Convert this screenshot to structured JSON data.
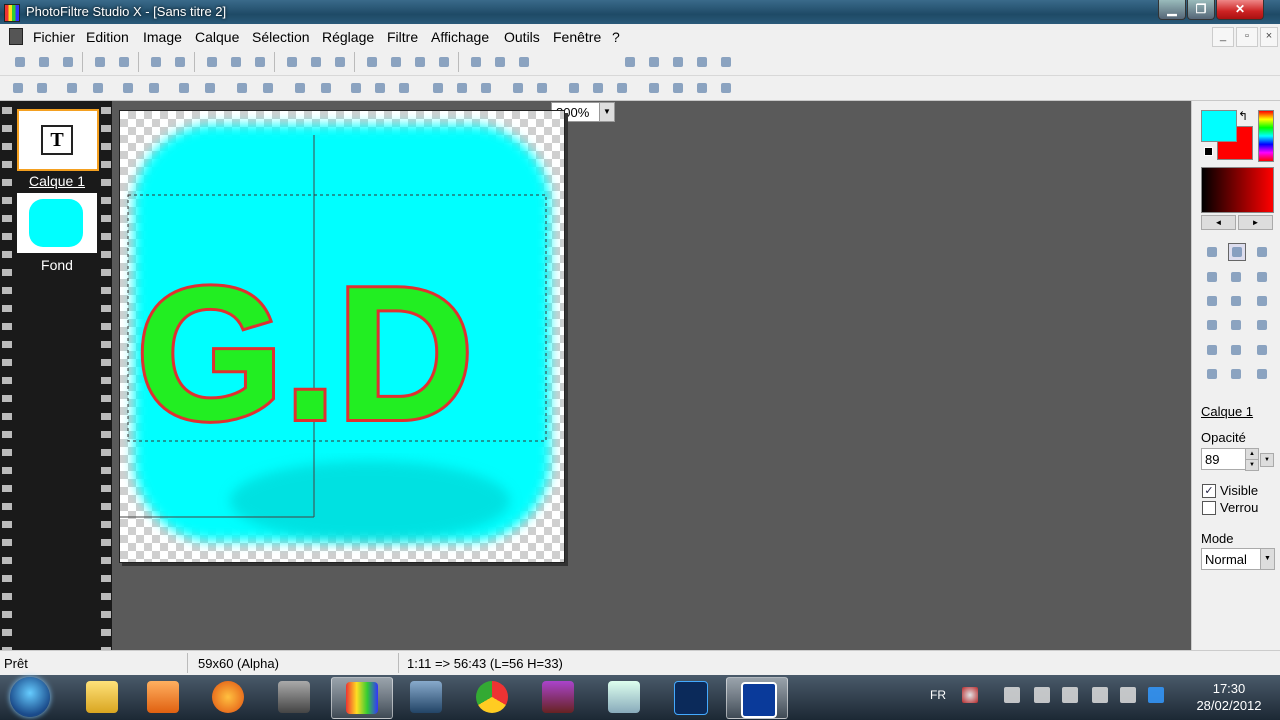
{
  "window": {
    "title": "PhotoFiltre Studio X - [Sans titre 2]"
  },
  "window_buttons": {
    "minimize": "▁",
    "maximize": "❐",
    "close": "✕"
  },
  "menu": {
    "items": [
      "Fichier",
      "Edition",
      "Image",
      "Calque",
      "Sélection",
      "Réglage",
      "Filtre",
      "Affichage",
      "Outils",
      "Fenêtre",
      "?"
    ]
  },
  "mdi_buttons": {
    "minimize": "_",
    "restore": "▫",
    "close": "×"
  },
  "toolbar": {
    "zoom": "800%"
  },
  "layers": [
    {
      "name": "Calque 1",
      "thumb_text": "T",
      "selected": true
    },
    {
      "name": "Fond",
      "selected": false
    }
  ],
  "canvas": {
    "text": "G.D",
    "bg_color": "#00ffff",
    "text_fill": "#22ee22",
    "text_outline": "#e03030"
  },
  "right_panel": {
    "fg_color": "#00ffff",
    "bg_color": "#ff0000",
    "swap_symbol": "↰",
    "layer_name": "Calque 1",
    "opacity_label": "Opacité",
    "opacity_value": "89",
    "visible_label": "Visible",
    "visible_checked": true,
    "lock_label": "Verrou",
    "lock_checked": false,
    "mode_label": "Mode",
    "mode_value": "Normal",
    "check_mark": "✓",
    "arrow_left": "◄",
    "arrow_right": "►",
    "spin_up": "▲",
    "spin_down": "▼",
    "dropdown_arrow": "▼"
  },
  "tools": [
    "pointer-icon",
    "selection-icon",
    "hand-icon",
    "eyedropper-icon",
    "magic-wand-icon",
    "line-icon",
    "fill-bucket-icon",
    "spray-icon",
    "eraser-icon",
    "brush-icon",
    "smart-brush-icon",
    "stamp-icon",
    "drop-icon",
    "smudge-icon",
    "pen-icon",
    "clone-icon",
    "texture-icon",
    "heart-icon"
  ],
  "status": {
    "ready": "Prêt",
    "size": "59x60 (Alpha)",
    "coords": "1:11 => 56:43 (L=56  H=33)"
  },
  "taskbar": {
    "lang": "FR",
    "time": "17:30",
    "date": "28/02/2012"
  }
}
